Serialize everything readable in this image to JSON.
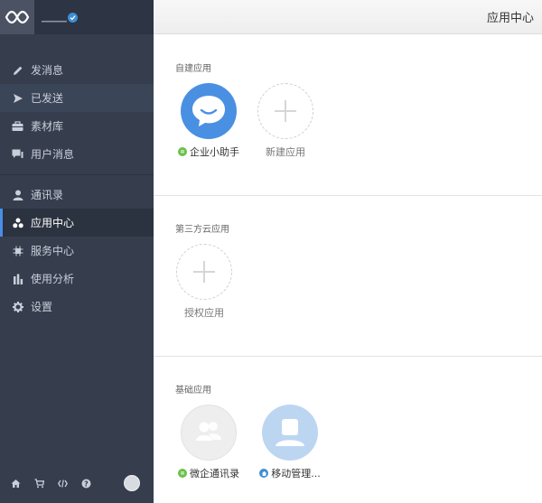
{
  "sidebar": {
    "brand_name": "▁▁▁▁",
    "groups": [
      {
        "items": [
          {
            "label": "发消息",
            "icon": "pencil-icon"
          },
          {
            "label": "已发送",
            "icon": "send-icon"
          },
          {
            "label": "素材库",
            "icon": "briefcase-icon"
          },
          {
            "label": "用户消息",
            "icon": "chat-icon"
          }
        ]
      },
      {
        "items": [
          {
            "label": "通讯录",
            "icon": "person-icon"
          },
          {
            "label": "应用中心",
            "icon": "apps-icon",
            "active": true
          },
          {
            "label": "服务中心",
            "icon": "chip-icon"
          },
          {
            "label": "使用分析",
            "icon": "bar-chart-icon"
          },
          {
            "label": "设置",
            "icon": "gear-icon"
          }
        ]
      }
    ],
    "bottom_icons": [
      "home-icon",
      "cart-icon",
      "code-icon",
      "help-icon",
      "avatar"
    ]
  },
  "header": {
    "title": "应用中心"
  },
  "sections": [
    {
      "title": "自建应用",
      "apps": [
        {
          "label": "企业小助手",
          "kind": "assistant",
          "badge": "green"
        },
        {
          "label": "新建应用",
          "kind": "add"
        }
      ]
    },
    {
      "title": "第三方云应用",
      "apps": [
        {
          "label": "授权应用",
          "kind": "add"
        }
      ]
    },
    {
      "title": "基础应用",
      "apps": [
        {
          "label": "微企通讯录",
          "kind": "contacts",
          "badge": "green"
        },
        {
          "label": "移动管理...",
          "kind": "mobile",
          "badge": "blue"
        }
      ]
    }
  ],
  "colors": {
    "sidebar_bg": "#363e4e",
    "accent": "#4a8ee6",
    "assistant_blue": "#4a90e2",
    "badge_green": "#6cc14a",
    "badge_blue": "#3e8ed6"
  }
}
